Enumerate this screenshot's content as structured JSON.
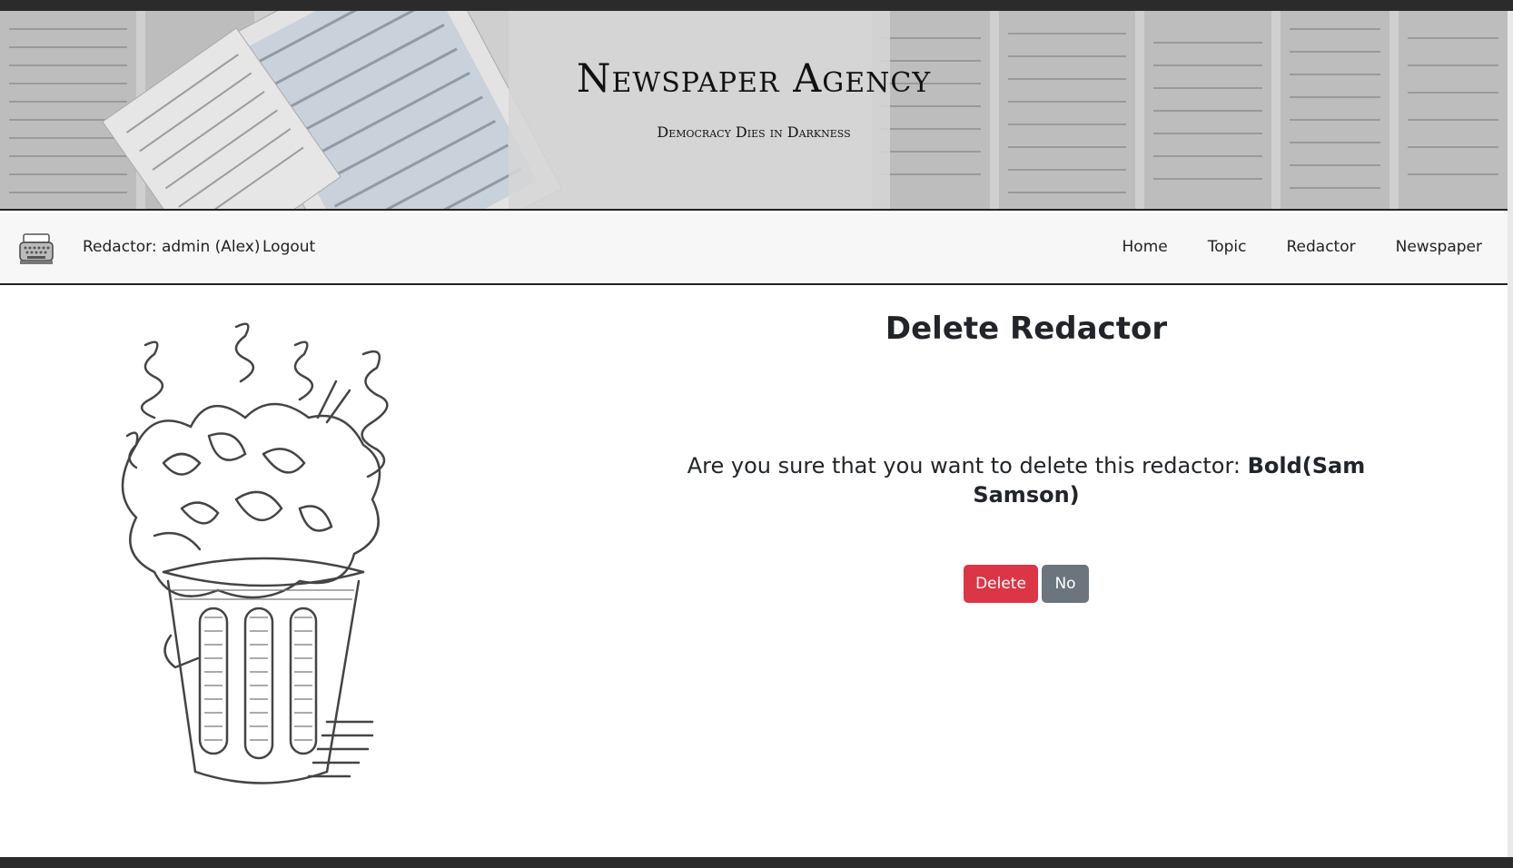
{
  "banner": {
    "title": "Newspaper Agency",
    "subtitle": "Democracy Dies in Darkness"
  },
  "navbar": {
    "logo_icon": "typewriter-icon",
    "user_label": "Redactor: admin (Alex)",
    "logout_label": "Logout",
    "links": [
      "Home",
      "Topic",
      "Redactor",
      "Newspaper"
    ]
  },
  "main": {
    "illustration_icon": "trash-can-icon",
    "heading": "Delete Redactor",
    "question_text": "Are you sure that you want to delete this redactor: ",
    "redactor_name": "Bold(Sam Samson)",
    "delete_label": "Delete",
    "no_label": "No"
  },
  "colors": {
    "danger": "#dc3545",
    "secondary": "#6c757d",
    "navbar_bg": "#f7f7f7"
  }
}
